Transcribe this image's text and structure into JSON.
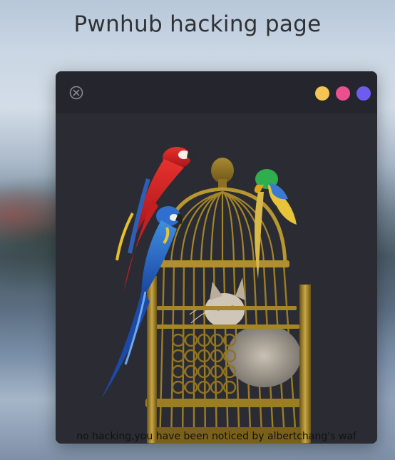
{
  "page": {
    "title": "Pwnhub hacking page"
  },
  "window": {
    "close_icon": "close-circle-icon",
    "dots": [
      {
        "name": "yellow",
        "color": "#f5c454"
      },
      {
        "name": "pink",
        "color": "#ea4f8f"
      },
      {
        "name": "purple",
        "color": "#6e5cf0"
      }
    ],
    "image": {
      "subject": "parrots-and-cat-in-birdcage"
    },
    "message": "no hacking,you have been noticed by albertchang's waf"
  }
}
